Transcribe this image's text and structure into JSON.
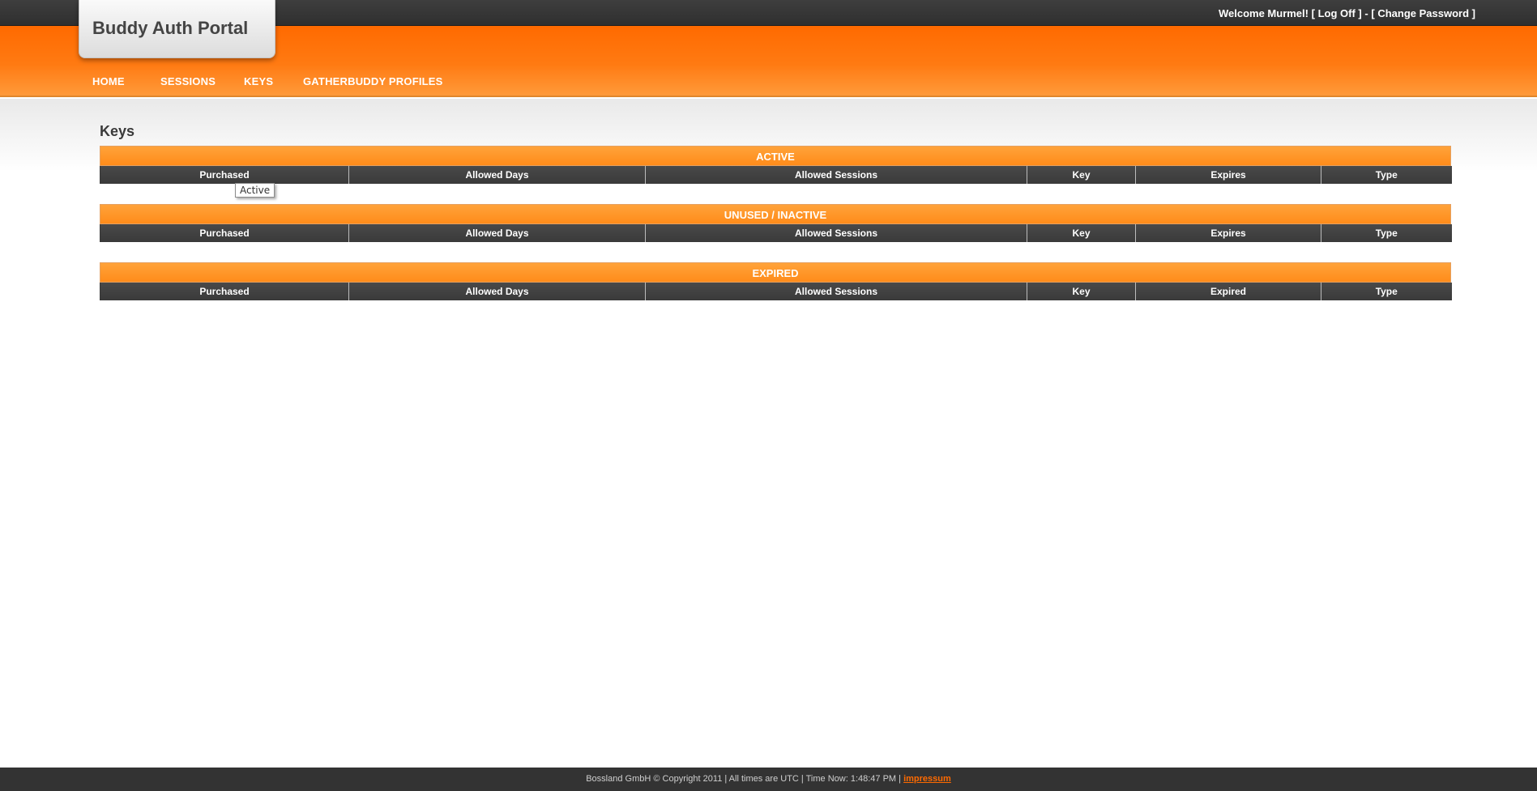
{
  "app": {
    "title": "Buddy Auth Portal"
  },
  "userbar": {
    "welcome": "Welcome Murmel!",
    "log_off_open": "[",
    "log_off": "Log Off",
    "log_off_close": "]",
    "separator": "-",
    "change_password_open": "[",
    "change_password": "Change Password",
    "change_password_close": "]"
  },
  "nav": {
    "items": [
      {
        "label": "HOME"
      },
      {
        "label": "SESSIONS"
      },
      {
        "label": "KEYS"
      },
      {
        "label": "GATHERBUDDY PROFILES"
      }
    ]
  },
  "main": {
    "page_title": "Keys",
    "sections": [
      {
        "title": "ACTIVE",
        "columns": [
          "Purchased",
          "Allowed Days",
          "Allowed Sessions",
          "Key",
          "Expires",
          "Type"
        ]
      },
      {
        "title": "UNUSED / INACTIVE",
        "columns": [
          "Purchased",
          "Allowed Days",
          "Allowed Sessions",
          "Key",
          "Expires",
          "Type"
        ]
      },
      {
        "title": "EXPIRED",
        "columns": [
          "Purchased",
          "Allowed Days",
          "Allowed Sessions",
          "Key",
          "Expired",
          "Type"
        ]
      }
    ],
    "tooltip": "Active"
  },
  "footer": {
    "text": "Bossland GmbH © Copyright 2011 | All times are UTC | Time Now: 1:48:47 PM |",
    "impressum": "impressum"
  },
  "colors": {
    "orange": "#ff6a00",
    "dark": "#333333",
    "section_orange": "#ff8c1a"
  }
}
